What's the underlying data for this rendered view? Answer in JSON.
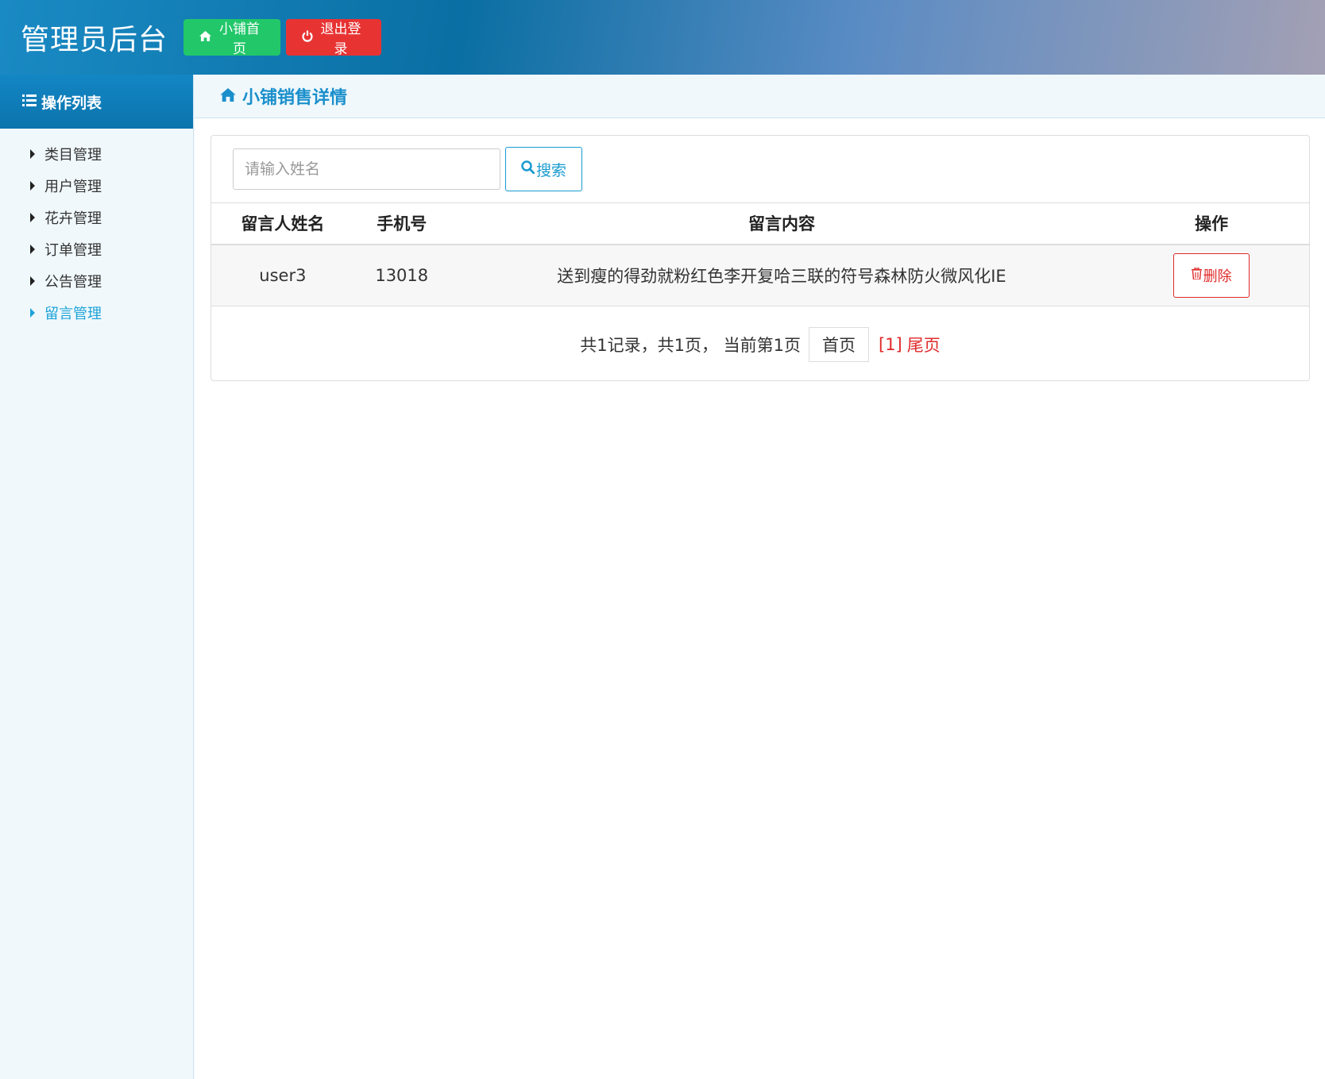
{
  "header": {
    "title": "管理员后台",
    "home_button": "小铺首页",
    "logout_button": "退出登录",
    "home_icon": "home-icon",
    "logout_icon": "power-icon"
  },
  "sidebar": {
    "title": "操作列表",
    "title_icon": "list-icon",
    "items": [
      {
        "label": "类目管理"
      },
      {
        "label": "用户管理"
      },
      {
        "label": "花卉管理"
      },
      {
        "label": "订单管理"
      },
      {
        "label": "公告管理"
      },
      {
        "label": "留言管理"
      }
    ],
    "active_index": 5
  },
  "main": {
    "title": "小铺销售详情",
    "title_icon": "home-icon",
    "search": {
      "placeholder": "请输入姓名",
      "value": "",
      "button": "搜索"
    },
    "table": {
      "columns": [
        "留言人姓名",
        "手机号",
        "留言内容",
        "操作"
      ],
      "rows": [
        {
          "name": "user3",
          "phone": "13018",
          "content": "送到瘦的得劲就粉红色李开复哈三联的符号森林防火微风化IE",
          "action": "删除"
        }
      ]
    },
    "pager": {
      "summary": "共1记录，共1页， 当前第1页",
      "first": "首页",
      "current": "[1]",
      "last": "尾页"
    }
  },
  "colors": {
    "accent": "#1a8fcb",
    "green": "#22c76a",
    "red": "#e83333"
  }
}
